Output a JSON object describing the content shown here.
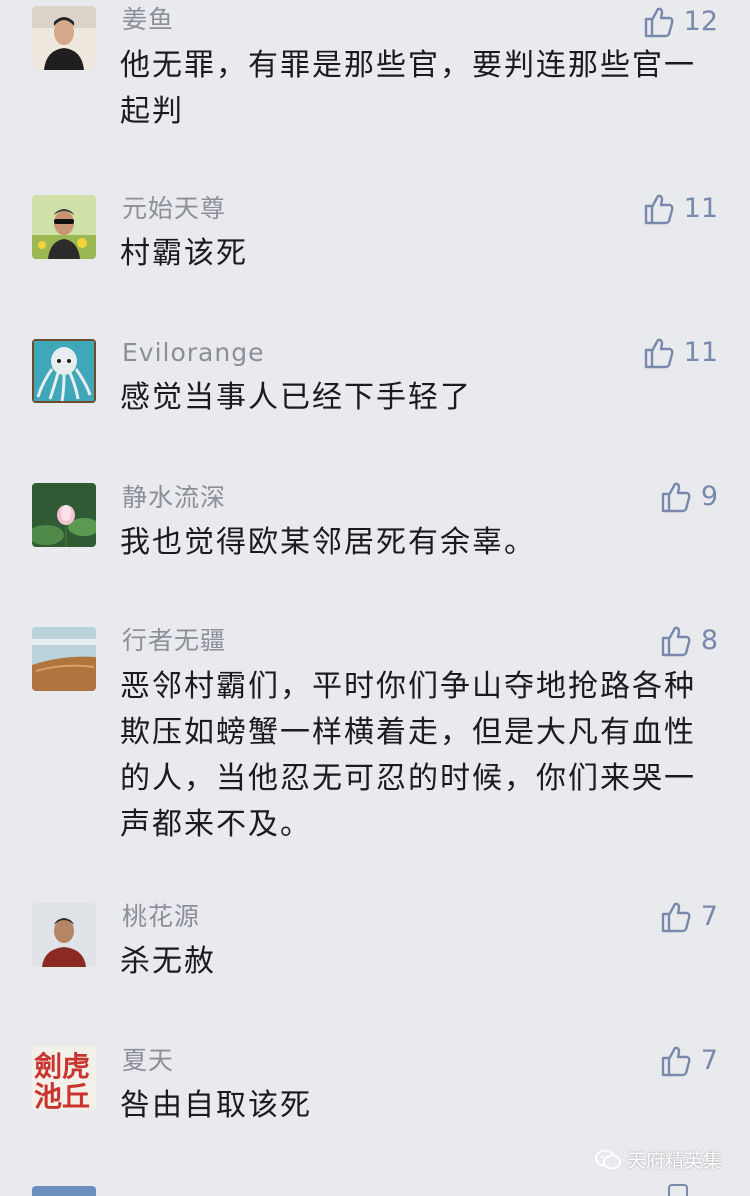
{
  "comments": [
    {
      "username": "姜鱼",
      "text": "他无罪，有罪是那些官，要判连那些官一起判",
      "likes": "12"
    },
    {
      "username": "元始天尊",
      "text": "村霸该死",
      "likes": "11"
    },
    {
      "username": "Evilorange",
      "text": "感觉当事人已经下手轻了",
      "likes": "11"
    },
    {
      "username": "静水流深",
      "text": "我也觉得欧某邻居死有余辜。",
      "likes": "9"
    },
    {
      "username": "行者无疆",
      "text": "恶邻村霸们，平时你们争山夺地抢路各种欺压如螃蟹一样横着走，但是大凡有血性的人，当他忍无可忍的时候，你们来哭一声都来不及。",
      "likes": "8"
    },
    {
      "username": "桃花源",
      "text": "杀无赦",
      "likes": "7"
    },
    {
      "username": "夏天",
      "text": "咎由自取该死",
      "likes": "7"
    }
  ],
  "avatar_7_text": "劍虎池丘",
  "watermark": "天府精英集",
  "colors": {
    "background": "#e9eaee",
    "username": "#8d8f98",
    "comment_text": "#1b1b1d",
    "like_icon": "#7a89ab"
  },
  "icons": {
    "like": "thumbs-up-icon",
    "watermark": "wechat-icon"
  }
}
